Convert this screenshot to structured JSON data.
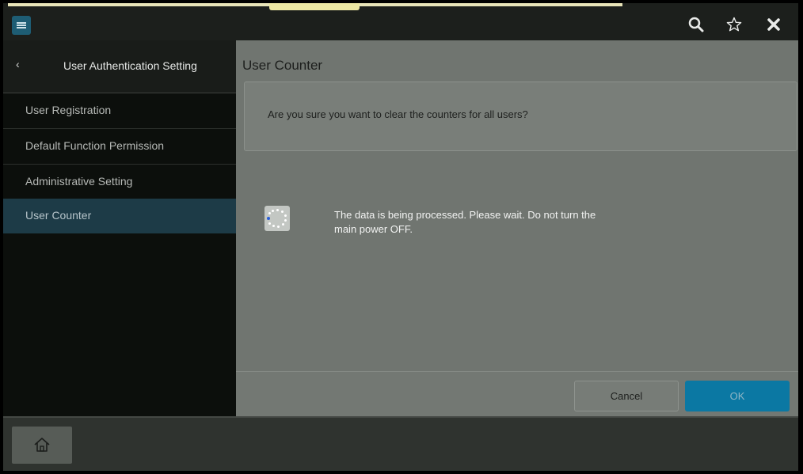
{
  "topbar": {
    "menu_icon": "hamburger-menu-icon",
    "search_icon": "search-icon",
    "favorite_icon": "star-outline-icon",
    "close_icon": "close-icon"
  },
  "sidebar": {
    "back_icon": "chevron-left-icon",
    "back_label": "‹",
    "title": "User Authentication Setting",
    "items": [
      {
        "label": "User Registration",
        "active": false
      },
      {
        "label": "Default Function Permission",
        "active": false
      },
      {
        "label": "Administrative Setting",
        "active": false
      },
      {
        "label": "User Counter",
        "active": true
      }
    ]
  },
  "main": {
    "title": "User Counter",
    "confirm_message": "Are you sure you want to clear the counters for all users?",
    "processing_message": "The data is being processed. Please wait. Do not turn the main power OFF.",
    "cancel_label": "Cancel",
    "ok_label": "OK"
  },
  "bottombar": {
    "home_icon": "home-icon"
  },
  "colors": {
    "accent": "#0b78a3",
    "sidebar_active": "#1d3b47",
    "overlay_gray": "#707570"
  }
}
